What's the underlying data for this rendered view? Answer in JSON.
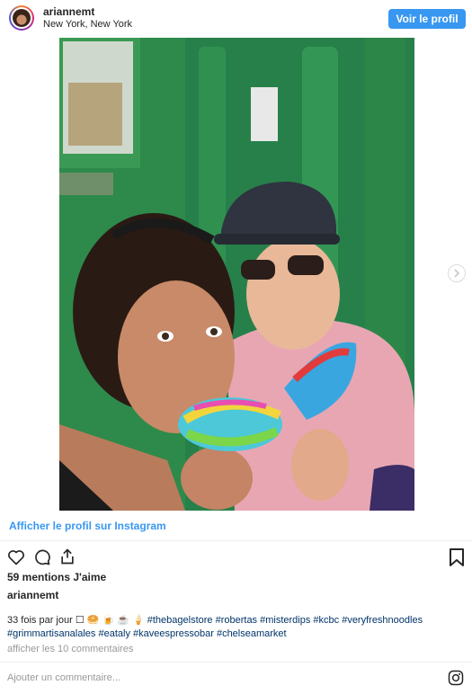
{
  "header": {
    "username": "ariannemt",
    "location": "New York, New York",
    "profile_button": "Voir le profil"
  },
  "view_profile_link": "Afficher le profil sur Instagram",
  "actions": {
    "like_icon": "heart-icon",
    "comment_icon": "comment-icon",
    "share_icon": "share-icon",
    "save_icon": "bookmark-icon"
  },
  "likes_text": "59 mentions J'aime",
  "caption": {
    "author": "ariannemt",
    "text": "33 fois par jour ☐ 🥯 🍺 ☕ 🍦 ",
    "hashtags": "#thebagelstore #robertas #misterdips #kcbc #veryfreshnoodles #grimmartisanalales #eataly #kaveespressobar #chelseamarket"
  },
  "comments_link": "afficher les 10 commentaires",
  "comment_placeholder": "Ajouter un commentaire...",
  "colors": {
    "accent": "#3897f0",
    "door_green": "#2e8a4a",
    "hashtag": "#003569"
  }
}
